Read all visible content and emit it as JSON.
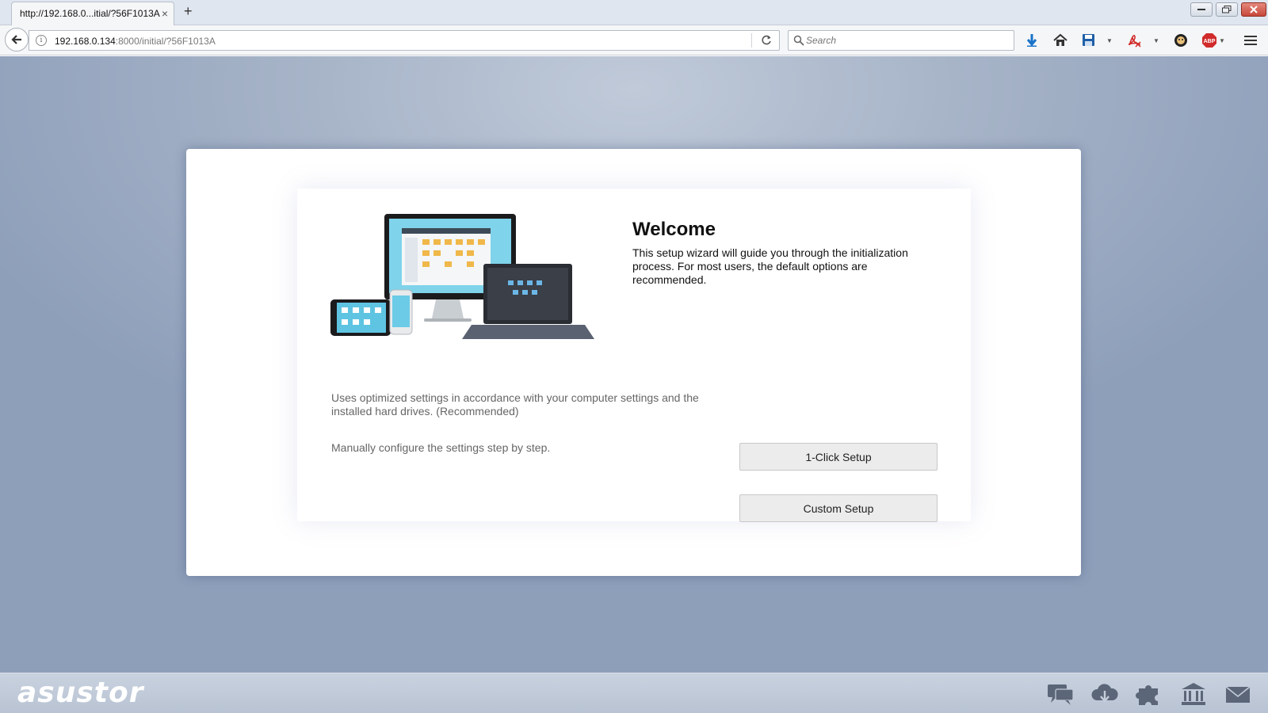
{
  "browser": {
    "tab_title": "http://192.168.0...itial/?56F1013A",
    "tab_close": "×",
    "new_tab": "+",
    "url_host": "192.168.0.134",
    "url_path": ":8000/initial/?56F1013A",
    "search_placeholder": "Search",
    "info_glyph": "i"
  },
  "wizard": {
    "title": "Welcome",
    "description": "This setup wizard will guide you through the initialization process. For most users, the default options are recommended.",
    "options": [
      {
        "text": "Uses optimized settings in accordance with your computer settings and the installed hard drives. (Recommended)",
        "button": "1-Click Setup"
      },
      {
        "text": "Manually configure the settings step by step.",
        "button": "Custom Setup"
      }
    ]
  },
  "footer": {
    "logo": "asustor",
    "icons": [
      "chat-icon",
      "cloud-download-icon",
      "puzzle-icon",
      "bank-icon",
      "mail-icon"
    ]
  },
  "colors": {
    "background": "#a7b4c8",
    "panel": "#ffffff",
    "button": "#ececec",
    "download_arrow": "#1a73c9",
    "abp_red": "#d12b2b"
  }
}
